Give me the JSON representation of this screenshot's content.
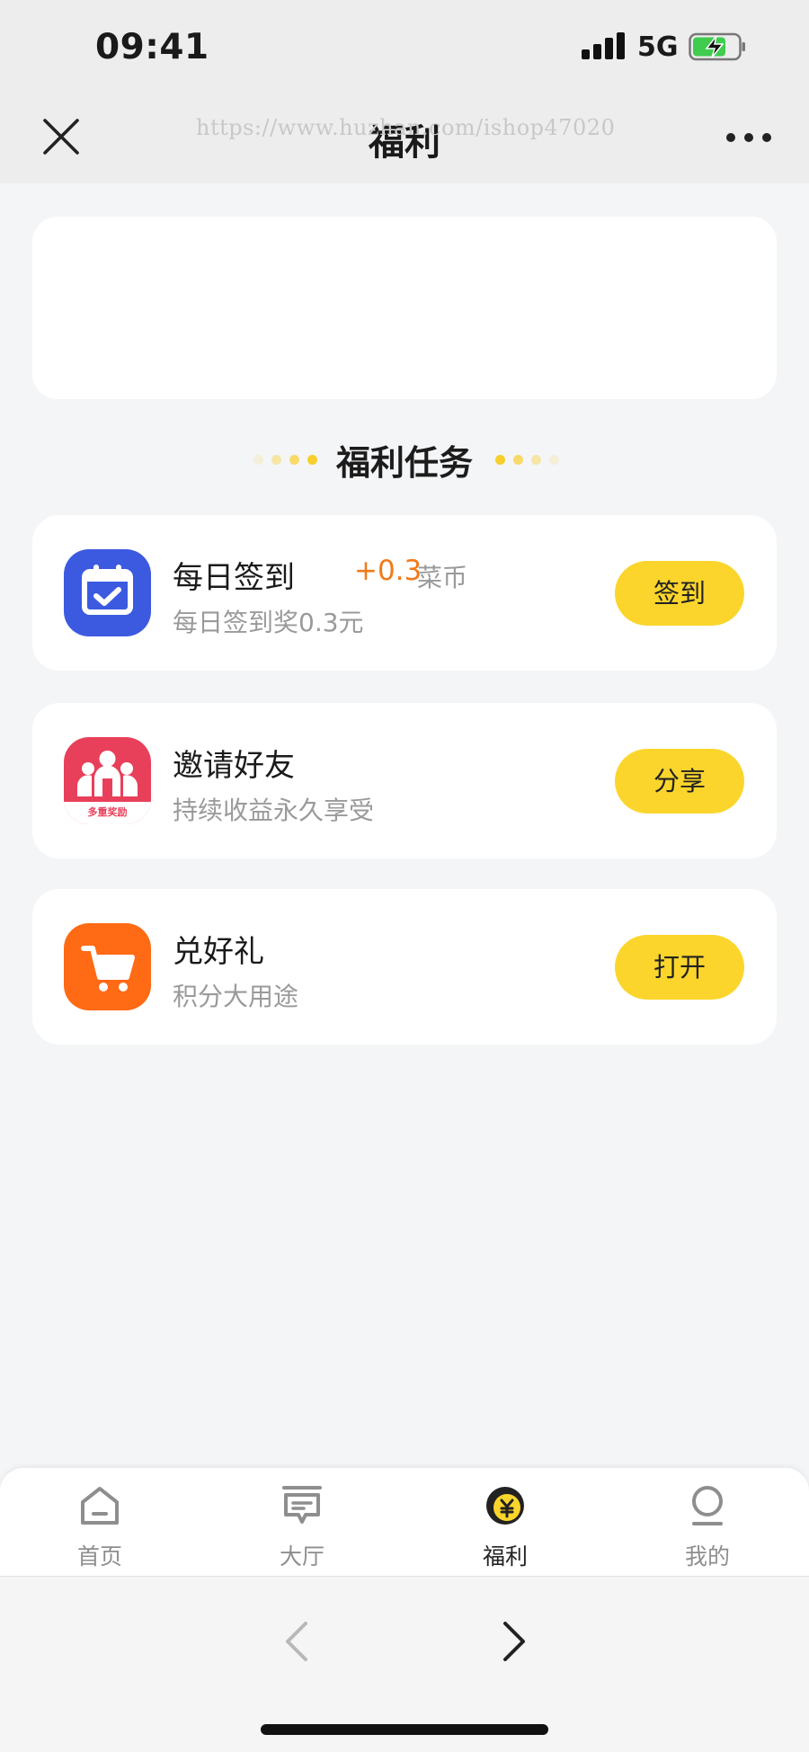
{
  "status_bar": {
    "time": "09:41",
    "network": "5G"
  },
  "title_bar": {
    "title": "福利",
    "watermark": "https://www.huzhan.com/ishop47020"
  },
  "section": {
    "title": "福利任务"
  },
  "tasks": [
    {
      "title": "每日签到",
      "reward_amount": "+0.3",
      "reward_unit": "菜币",
      "subtitle": "每日签到奖0.3元",
      "button": "签到",
      "icon": "calendar-check-icon",
      "icon_color": "#3c5ae0"
    },
    {
      "title": "邀请好友",
      "subtitle": "持续收益永久享受",
      "button": "分享",
      "icon": "invite-friends-icon",
      "icon_badge": "多重奖励",
      "icon_color": "#e8405a"
    },
    {
      "title": "兑好礼",
      "subtitle": "积分大用途",
      "button": "打开",
      "icon": "shopping-cart-icon",
      "icon_color": "#ff6a14"
    }
  ],
  "tabbar": {
    "items": [
      {
        "label": "首页",
        "icon": "home-icon",
        "active": false
      },
      {
        "label": "大厅",
        "icon": "hall-icon",
        "active": false
      },
      {
        "label": "福利",
        "icon": "welfare-coin-icon",
        "active": true
      },
      {
        "label": "我的",
        "icon": "profile-icon",
        "active": false
      }
    ]
  },
  "colors": {
    "accent": "#fbd52c",
    "reward": "#f07a1a",
    "background": "#f4f5f7"
  }
}
